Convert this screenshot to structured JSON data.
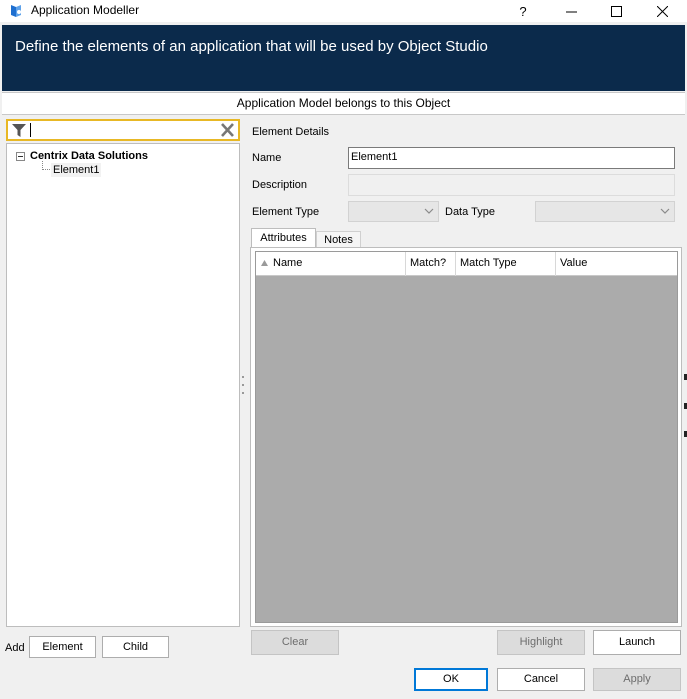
{
  "window": {
    "title": "Application Modeller",
    "help_symbol": "?",
    "minimize_symbol": "—",
    "maximize_symbol": "☐",
    "close_symbol": "✕",
    "icon": "blue-prism-app-icon"
  },
  "banner": {
    "text": "Define the elements of an application that will be used by Object Studio",
    "background": "#0b2a4b"
  },
  "belongs_header": "Application Model belongs to this Object",
  "search": {
    "value": "",
    "placeholder": "",
    "filter_icon": "filter-icon",
    "clear_icon": "clear-icon",
    "highlight_color": "#e8b825"
  },
  "tree": {
    "root_label": "Centrix Data Solutions",
    "children": [
      "Element1"
    ]
  },
  "add_controls": {
    "label": "Add",
    "element_button": "Element",
    "child_button": "Child"
  },
  "details": {
    "section_title": "Element Details",
    "name_label": "Name",
    "name_value": "Element1",
    "description_label": "Description",
    "description_value": "",
    "element_type_label": "Element Type",
    "element_type_value": "",
    "data_type_label": "Data Type",
    "data_type_value": ""
  },
  "tabs": [
    "Attributes",
    "Notes"
  ],
  "attributes_grid": {
    "columns": [
      "Name",
      "Match?",
      "Match Type",
      "Value"
    ],
    "rows": []
  },
  "action_buttons": {
    "clear": "Clear",
    "highlight": "Highlight",
    "launch": "Launch"
  },
  "footer_buttons": {
    "ok": "OK",
    "cancel": "Cancel",
    "apply": "Apply"
  },
  "colors": {
    "accent_blue": "#0078d7",
    "disabled_grey": "#dcdcdc"
  }
}
